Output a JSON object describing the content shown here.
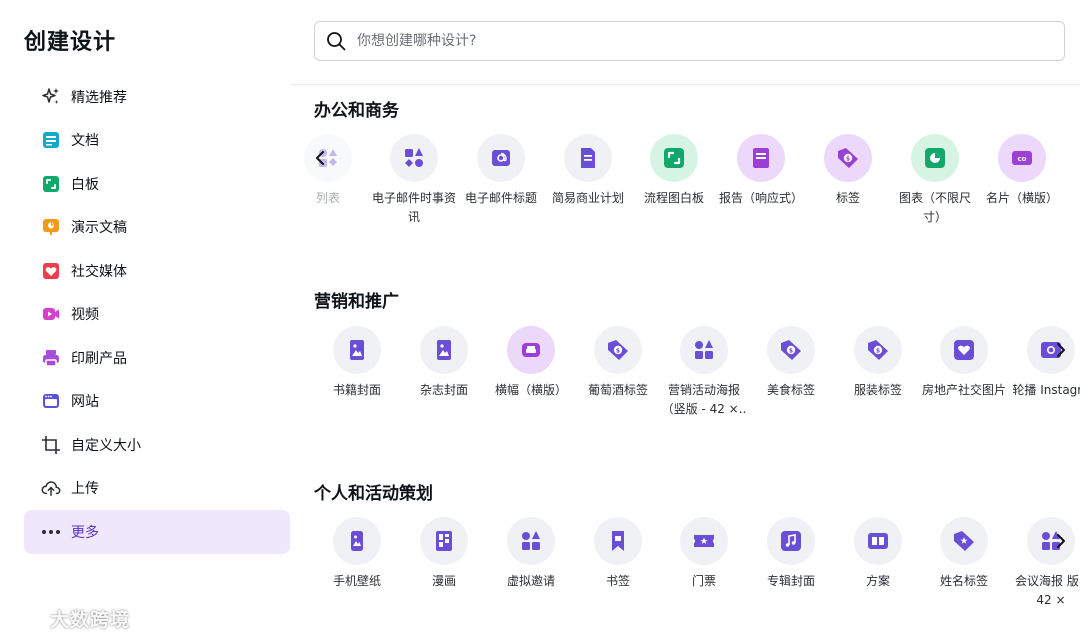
{
  "sidebar": {
    "title": "创建设计",
    "items": [
      {
        "label": "精选推荐",
        "icon": "sparkle-icon"
      },
      {
        "label": "文档",
        "icon": "doc-icon"
      },
      {
        "label": "白板",
        "icon": "whiteboard-icon"
      },
      {
        "label": "演示文稿",
        "icon": "presentation-icon"
      },
      {
        "label": "社交媒体",
        "icon": "heart-icon"
      },
      {
        "label": "视频",
        "icon": "video-icon"
      },
      {
        "label": "印刷产品",
        "icon": "printer-icon"
      },
      {
        "label": "网站",
        "icon": "website-icon"
      },
      {
        "label": "自定义大小",
        "icon": "resize-icon"
      },
      {
        "label": "上传",
        "icon": "upload-cloud-icon"
      },
      {
        "label": "更多",
        "icon": "more-dots-icon"
      }
    ],
    "active": "更多"
  },
  "search": {
    "placeholder": "你想创建哪种设计?"
  },
  "sections": [
    {
      "title": "办公和商务",
      "items": [
        {
          "label": "列表"
        },
        {
          "label": "电子邮件时事资讯"
        },
        {
          "label": "电子邮件标题"
        },
        {
          "label": "简易商业计划"
        },
        {
          "label": "流程图白板"
        },
        {
          "label": "报告（响应式）"
        },
        {
          "label": "标签"
        },
        {
          "label": "图表（不限尺寸）"
        },
        {
          "label": "名片（横版）"
        }
      ]
    },
    {
      "title": "营销和推广",
      "items": [
        {
          "label": "书籍封面"
        },
        {
          "label": "杂志封面"
        },
        {
          "label": "横幅（横版）"
        },
        {
          "label": "葡萄酒标签"
        },
        {
          "label": "营销活动海报（竖版 - 42 ×.."
        },
        {
          "label": "美食标签"
        },
        {
          "label": "服装标签"
        },
        {
          "label": "房地产社交图片"
        },
        {
          "label": "轮播 Instagra"
        }
      ]
    },
    {
      "title": "个人和活动策划",
      "items": [
        {
          "label": "手机壁纸"
        },
        {
          "label": "漫画"
        },
        {
          "label": "虚拟邀请"
        },
        {
          "label": "书签"
        },
        {
          "label": "门票"
        },
        {
          "label": "专辑封面"
        },
        {
          "label": "方案"
        },
        {
          "label": "姓名标签"
        },
        {
          "label": "会议海报 版 - 42 ×"
        }
      ]
    }
  ],
  "watermark": "大数跨境",
  "colors": {
    "accent": "#5a32c7",
    "icon_purple": "#6a4fd6",
    "green": "#13a86b",
    "active_bg": "#efe8fd"
  }
}
